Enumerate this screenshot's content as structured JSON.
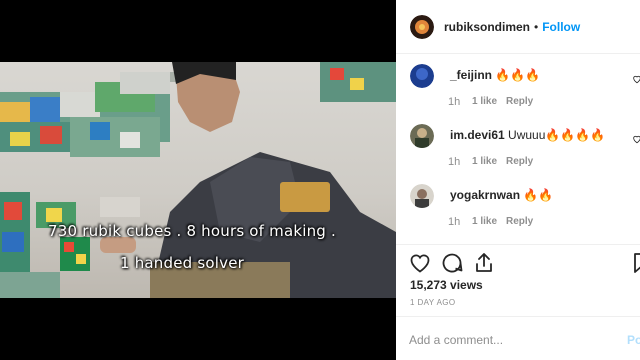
{
  "video": {
    "caption_line1": "730 rubik cubes . 8 hours of making .",
    "caption_line2": "1 handed solver"
  },
  "post": {
    "username": "rubiksondimen",
    "separator": "•",
    "follow_label": "Follow",
    "views": "15,273 views",
    "posted": "1 DAY AGO",
    "add_comment_placeholder": "Add a comment...",
    "post_button": "Po"
  },
  "comments": [
    {
      "username": "_feijinn",
      "text": "🔥🔥🔥",
      "time": "1h",
      "likes": "1 like",
      "reply": "Reply"
    },
    {
      "username": "im.devi61",
      "text": "Uwuuu🔥🔥🔥🔥",
      "time": "1h",
      "likes": "1 like",
      "reply": "Reply"
    },
    {
      "username": "yogakrnwan",
      "text": "🔥🔥",
      "time": "1h",
      "likes": "1 like",
      "reply": "Reply"
    }
  ],
  "icons": {
    "like": "heart-icon",
    "comment": "comment-icon",
    "share": "share-icon",
    "save": "bookmark-icon"
  },
  "colors": {
    "follow": "#0095f6",
    "text": "#262626",
    "muted": "#8e8e8e"
  }
}
